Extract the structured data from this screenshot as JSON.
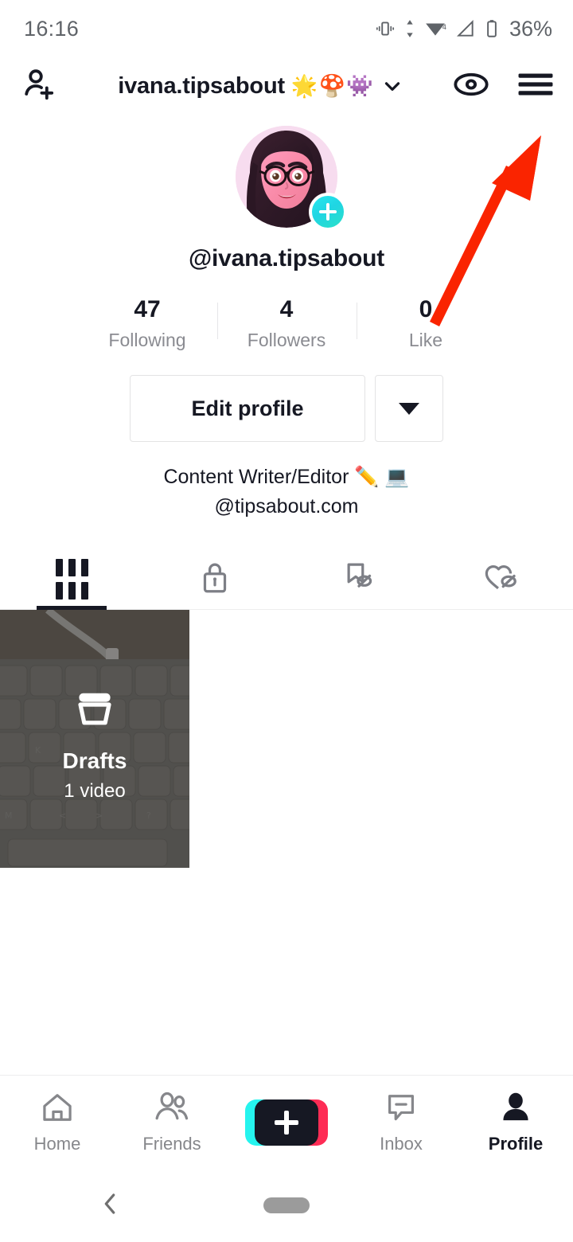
{
  "status_bar": {
    "time": "16:16",
    "battery_percent": "36%",
    "icons": [
      "vibrate-icon",
      "data-transfer-icon",
      "wifi-icon",
      "cellular-signal-icon",
      "battery-icon"
    ]
  },
  "header": {
    "add_friend_icon": "add-person-icon",
    "username": "ivana.tipsabout",
    "emojis": "🌟🍄👾",
    "dropdown_icon": "chevron-down-icon",
    "view_icon": "eye-icon",
    "menu_icon": "hamburger-menu-icon"
  },
  "profile": {
    "avatar_alt": "avatar-cartoon-woman-glasses",
    "add_badge_icon": "plus-icon",
    "handle": "@ivana.tipsabout",
    "stats": [
      {
        "count": "47",
        "label": "Following"
      },
      {
        "count": "4",
        "label": "Followers"
      },
      {
        "count": "0",
        "label": "Like"
      }
    ],
    "edit_button": "Edit profile",
    "more_button_icon": "caret-down-icon",
    "bio_line_1": "Content Writer/Editor ✏️ 💻",
    "bio_line_2": "@tipsabout.com"
  },
  "tabs": [
    {
      "name": "videos-tab",
      "icon": "grid-icon",
      "active": true
    },
    {
      "name": "private-tab",
      "icon": "lock-icon",
      "active": false
    },
    {
      "name": "saved-tab",
      "icon": "bookmark-hidden-icon",
      "active": false
    },
    {
      "name": "liked-tab",
      "icon": "heart-hidden-icon",
      "active": false
    }
  ],
  "content": {
    "drafts": {
      "icon": "drafts-box-icon",
      "title": "Drafts",
      "subtitle": "1 video"
    }
  },
  "bottom_nav": [
    {
      "label": "Home",
      "icon": "home-icon",
      "active": false
    },
    {
      "label": "Friends",
      "icon": "friends-icon",
      "active": false
    },
    {
      "label": "",
      "icon": "create-plus-icon",
      "active": false
    },
    {
      "label": "Inbox",
      "icon": "inbox-icon",
      "active": false
    },
    {
      "label": "Profile",
      "icon": "profile-person-icon",
      "active": true
    }
  ],
  "android_nav": {
    "back_icon": "back-chevron-icon",
    "home_pill": "home-indicator-pill"
  },
  "annotation": {
    "arrow_color": "#FA2400",
    "points_to": "hamburger-menu-icon"
  },
  "colors": {
    "text_primary": "#161823",
    "text_secondary": "#8a8b91",
    "tiktok_cyan": "#25f4ee",
    "tiktok_pink": "#fe2c55",
    "annotation_red": "#FA2400"
  }
}
